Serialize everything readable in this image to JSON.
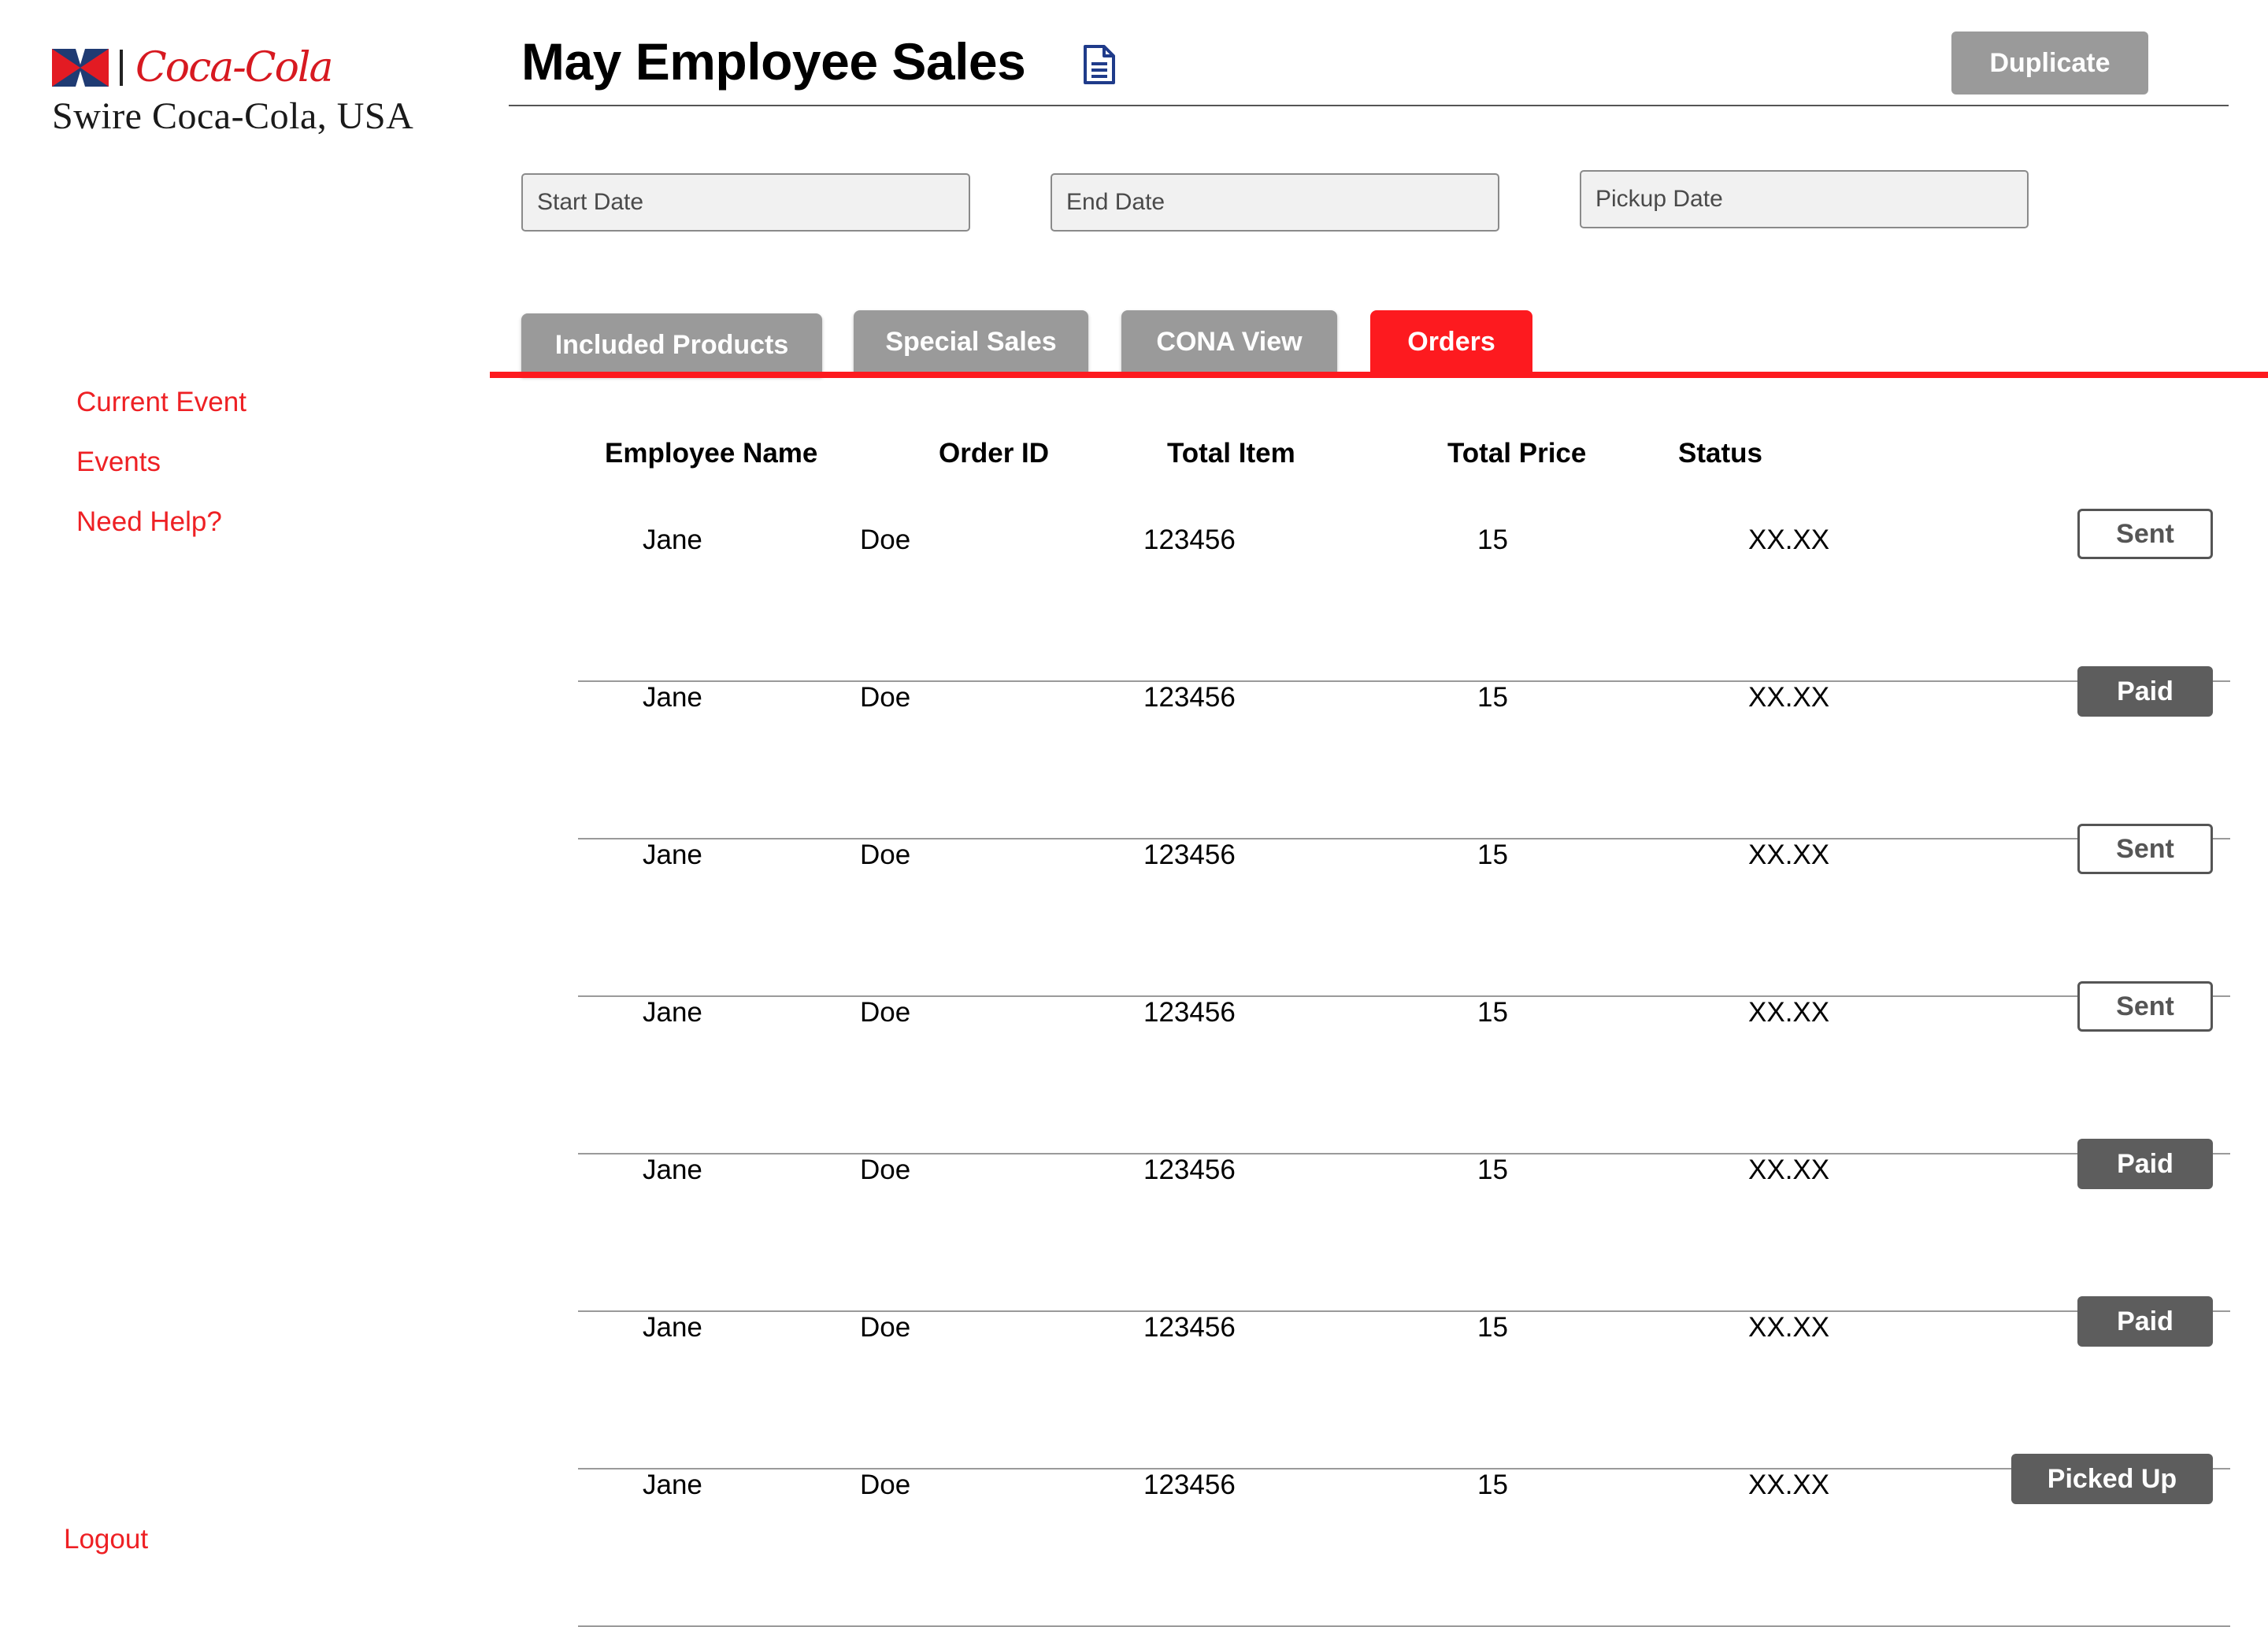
{
  "brand": {
    "script": "Coca-Cola",
    "name": "Swire Coca-Cola, USA",
    "colors": {
      "red": "#ee2024",
      "flag_blue": "#1f3b73"
    }
  },
  "sidebar": {
    "current_event": "Current Event",
    "events": "Events",
    "help": "Need Help?",
    "logout": "Logout"
  },
  "header": {
    "title": "May Employee Sales",
    "doc_icon": "document-icon",
    "duplicate_label": "Duplicate"
  },
  "dates": {
    "start_placeholder": "Start Date",
    "end_placeholder": "End Date",
    "pickup_placeholder": "Pickup Date"
  },
  "tabs": {
    "included": "Included Products",
    "special": "Special Sales",
    "cona": "CONA View",
    "orders": "Orders",
    "active": "Orders",
    "active_color": "#fd1a1f",
    "inactive_color": "#9a9a9a"
  },
  "table": {
    "headers": {
      "name": "Employee Name",
      "order_id": "Order ID",
      "total_item": "Total Item",
      "total_price": "Total Price",
      "status": "Status"
    },
    "rows": [
      {
        "first": "Jane",
        "last": "Doe",
        "order_id": "123456",
        "items": "15",
        "price": "XX.XX",
        "status": "Sent"
      },
      {
        "first": "Jane",
        "last": "Doe",
        "order_id": "123456",
        "items": "15",
        "price": "XX.XX",
        "status": "Paid"
      },
      {
        "first": "Jane",
        "last": "Doe",
        "order_id": "123456",
        "items": "15",
        "price": "XX.XX",
        "status": "Sent"
      },
      {
        "first": "Jane",
        "last": "Doe",
        "order_id": "123456",
        "items": "15",
        "price": "XX.XX",
        "status": "Sent"
      },
      {
        "first": "Jane",
        "last": "Doe",
        "order_id": "123456",
        "items": "15",
        "price": "XX.XX",
        "status": "Paid"
      },
      {
        "first": "Jane",
        "last": "Doe",
        "order_id": "123456",
        "items": "15",
        "price": "XX.XX",
        "status": "Paid"
      },
      {
        "first": "Jane",
        "last": "Doe",
        "order_id": "123456",
        "items": "15",
        "price": "XX.XX",
        "status": "Picked Up"
      }
    ]
  }
}
